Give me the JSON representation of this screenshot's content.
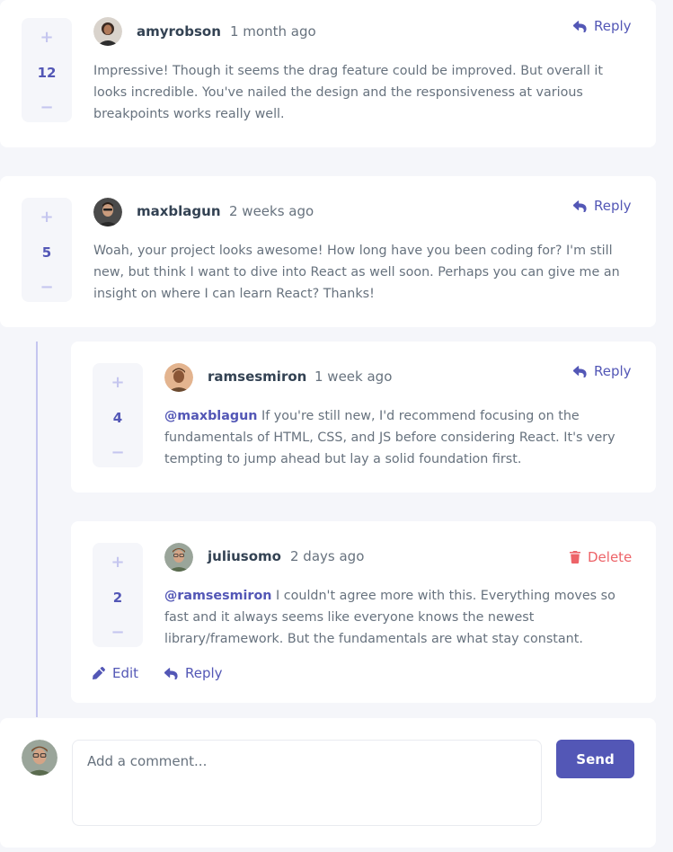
{
  "comments": [
    {
      "score": "12",
      "username": "amyrobson",
      "timestamp": "1 month ago",
      "action_label": "Reply",
      "content": "Impressive! Though it seems the drag feature could be improved. But overall it looks incredible. You've nailed the design and the responsiveness at various breakpoints works really well."
    },
    {
      "score": "5",
      "username": "maxblagun",
      "timestamp": "2 weeks ago",
      "action_label": "Reply",
      "content": "Woah, your project looks awesome! How long have you been coding for? I'm still new, but think I want to dive into React as well soon. Perhaps you can give me an insight on where I can learn React? Thanks!"
    }
  ],
  "replies": [
    {
      "score": "4",
      "username": "ramsesmiron",
      "timestamp": "1 week ago",
      "action_label": "Reply",
      "mention": "@maxblagun",
      "content": " If you're still new, I'd recommend focusing on the fundamentals of HTML, CSS, and JS before considering React. It's very tempting to jump ahead but lay a solid foundation first."
    },
    {
      "score": "2",
      "username": "juliusomo",
      "timestamp": "2 days ago",
      "delete_label": "Delete",
      "edit_label": "Edit",
      "reply_label": "Reply",
      "mention": "@ramsesmiron",
      "content": " I couldn't agree more with this. Everything moves so fast and it always seems like everyone knows the newest library/framework. But the fundamentals are what stay constant."
    }
  ],
  "new_comment": {
    "placeholder": "Add a comment...",
    "send_label": "Send"
  },
  "vote": {
    "plus": "+",
    "minus": "−"
  },
  "colors": {
    "primary": "#5357b6",
    "danger": "#ed6368",
    "background": "#f5f6fa",
    "muted": "#c5c6ef"
  }
}
